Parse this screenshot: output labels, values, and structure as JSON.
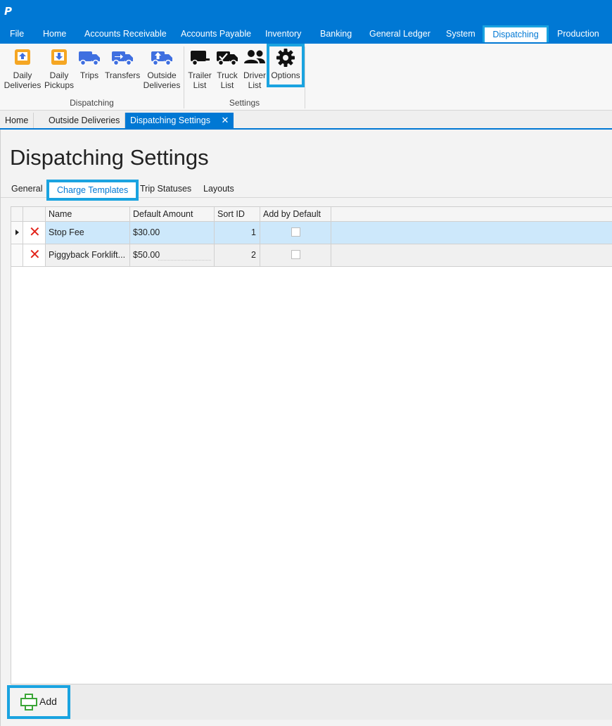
{
  "app": {
    "logo_letter": "P"
  },
  "menu": {
    "items": [
      "File",
      "Home",
      "Accounts Receivable",
      "Accounts Payable",
      "Inventory",
      "Banking",
      "General Ledger",
      "System",
      "Dispatching",
      "Production"
    ],
    "active": "Dispatching"
  },
  "ribbon": {
    "dispatching_group": "Dispatching",
    "settings_group": "Settings",
    "buttons": {
      "daily_deliveries": [
        "Daily",
        "Deliveries"
      ],
      "daily_pickups": [
        "Daily",
        "Pickups"
      ],
      "trips": "Trips",
      "transfers": "Transfers",
      "outside_deliveries": [
        "Outside",
        "Deliveries"
      ],
      "trailer_list": [
        "Trailer",
        "List"
      ],
      "truck_list": [
        "Truck",
        "List"
      ],
      "driver_list": [
        "Driver",
        "List"
      ],
      "options": "Options"
    },
    "icon_colors": {
      "orange": "#f5a623",
      "blue": "#3f6fe0",
      "black": "#111111"
    }
  },
  "doc_tabs": {
    "items": [
      "Home",
      "Outside Deliveries",
      "Dispatching Settings"
    ],
    "active": "Dispatching Settings",
    "close_glyph": "✕"
  },
  "page": {
    "title": "Dispatching Settings"
  },
  "sub_tabs": {
    "items": [
      "General",
      "Charge Templates",
      "Trip Statuses",
      "Layouts"
    ],
    "active": "Charge Templates"
  },
  "grid": {
    "columns": [
      "Name",
      "Default Amount",
      "Sort ID",
      "Add by Default"
    ],
    "rows": [
      {
        "name": "Stop Fee",
        "default_amount": "$30.00",
        "sort_id": "1",
        "add_by_default": false,
        "selected": true
      },
      {
        "name": "Piggyback Forklift...",
        "default_amount": "$50.00",
        "sort_id": "2",
        "add_by_default": false,
        "selected": false
      }
    ],
    "delete_glyph": "✕"
  },
  "footer": {
    "add_label": "Add"
  },
  "colors": {
    "accent": "#0078d4",
    "highlight_border": "#1aa3e0",
    "delete_red": "#e2231a",
    "add_green": "#3aa536",
    "selected_row": "#cde8fb"
  }
}
